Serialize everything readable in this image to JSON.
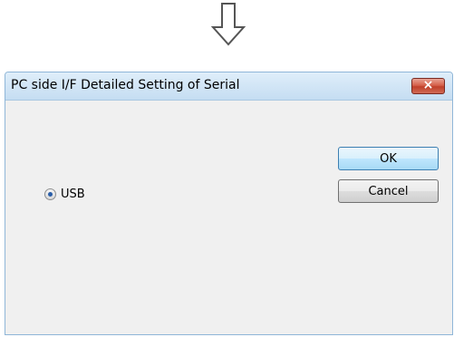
{
  "window": {
    "title": "PC side I/F Detailed Setting of Serial",
    "close_symbol": "×"
  },
  "options": {
    "usb_label": "USB",
    "usb_selected": true
  },
  "buttons": {
    "ok_label": "OK",
    "cancel_label": "Cancel"
  },
  "icons": {
    "arrow": "down-arrow-icon",
    "close": "close-icon",
    "radio": "radio-selected-icon"
  },
  "colors": {
    "titlebar": "#c5ddf2",
    "close_button": "#c8452f",
    "ok_button": "#bee6fd",
    "dialog_background": "#f0f0f0"
  }
}
